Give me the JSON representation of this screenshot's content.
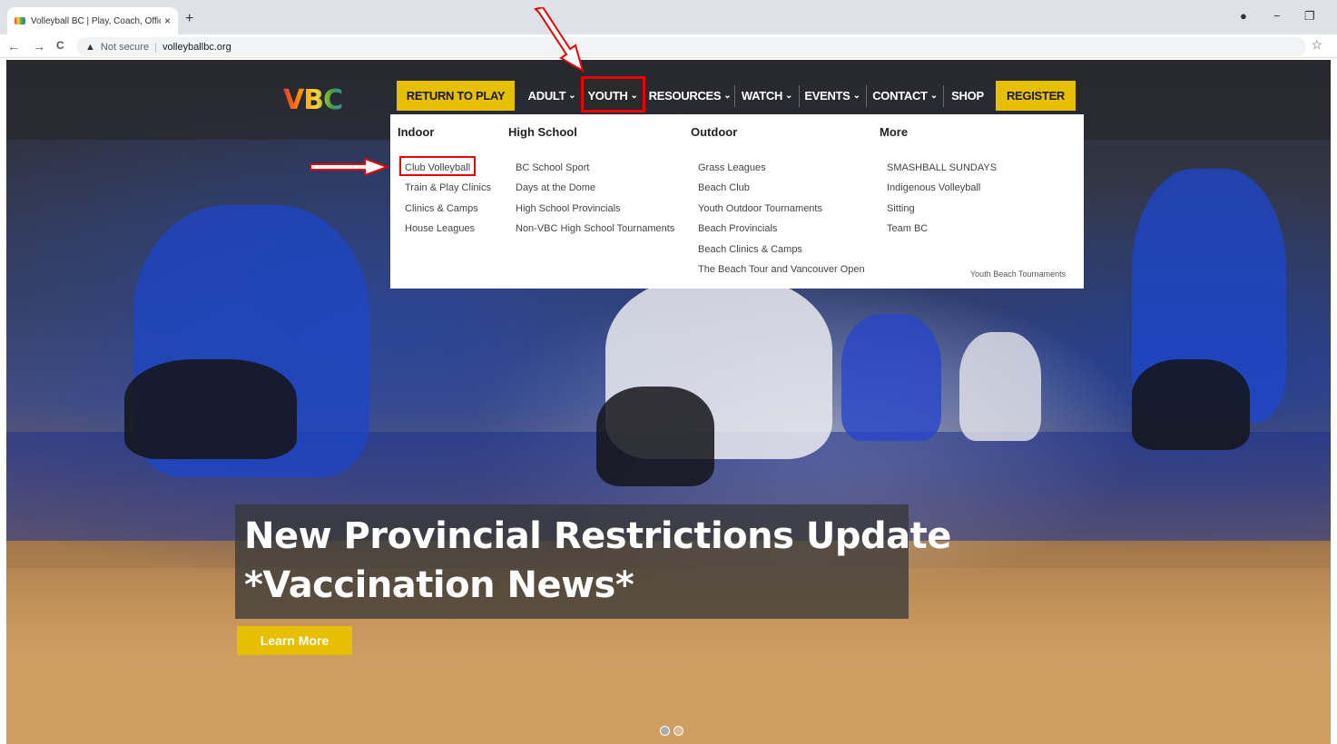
{
  "browser": {
    "tab_title": "Volleyball BC | Play, Coach, Offici",
    "tab_close": "×",
    "new_tab": "+",
    "back": "←",
    "forward": "→",
    "reload": "C",
    "warning_icon": "▲",
    "not_secure": "Not secure",
    "separator": "|",
    "url": "volleyballbc.org",
    "star": "☆",
    "profile": "●",
    "minimize": "−",
    "restore": "❐"
  },
  "site": {
    "logo": "VBC"
  },
  "nav": {
    "return_to_play": "RETURN TO PLAY",
    "adult": "ADULT",
    "youth": "YOUTH",
    "resources": "RESOURCES",
    "watch": "WATCH",
    "events": "EVENTS",
    "contact": "CONTACT",
    "shop": "SHOP",
    "register": "REGISTER",
    "caret": "⌄"
  },
  "dropdown": {
    "indoor": {
      "heading": "Indoor",
      "items": [
        "Club Volleyball",
        "Train & Play Clinics",
        "Clinics & Camps",
        "House Leagues"
      ]
    },
    "high_school": {
      "heading": "High School",
      "items": [
        "BC School Sport",
        "Days at the Dome",
        "High School Provincials",
        "Non-VBC High School Tournaments"
      ]
    },
    "outdoor": {
      "heading": "Outdoor",
      "items": [
        "Grass Leagues",
        "Beach Club",
        "Youth Outdoor Tournaments",
        "Beach Provincials",
        "Beach Clinics & Camps",
        "The Beach Tour and Vancouver Open"
      ]
    },
    "more": {
      "heading": "More",
      "items": [
        "SMASHBALL SUNDAYS",
        "Indigenous Volleyball",
        "Sitting",
        "Team BC"
      ],
      "extra": "Youth Beach Tournaments"
    }
  },
  "hero": {
    "headline_line1": "New Provincial Restrictions Update",
    "headline_line2": "*Vaccination News*",
    "cta": "Learn More"
  },
  "colors": {
    "accent_yellow": "#e6c000",
    "highlight_red": "#e00000"
  }
}
